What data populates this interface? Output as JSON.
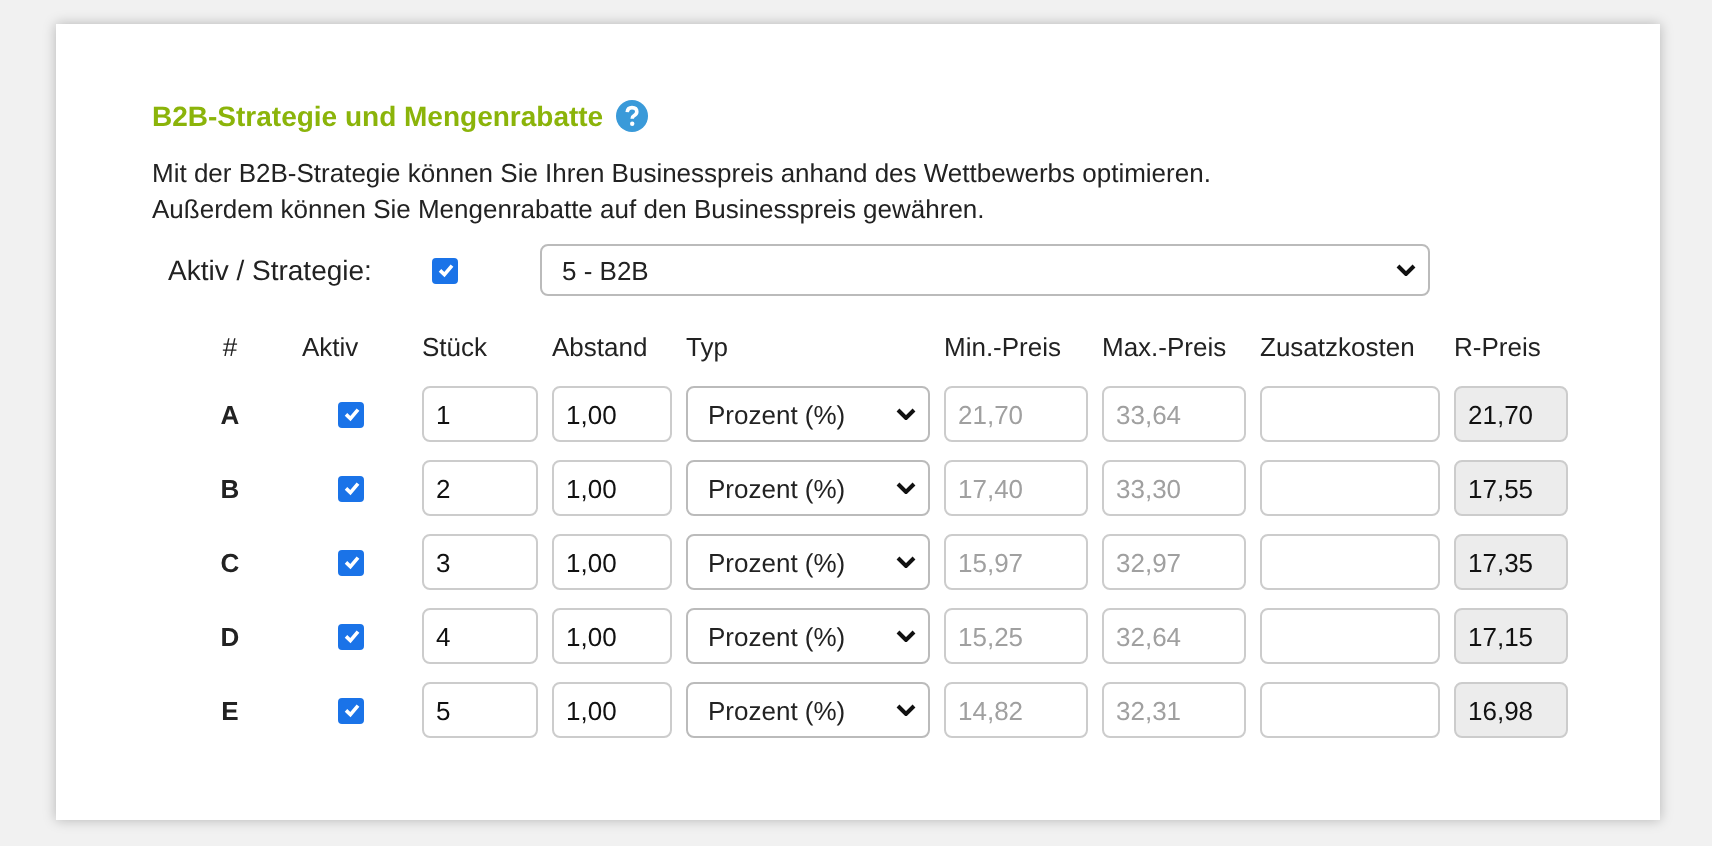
{
  "section": {
    "title": "B2B-Strategie und Mengenrabatte",
    "description": [
      "Mit der B2B-Strategie können Sie Ihren Businesspreis anhand des Wettbewerbs optimieren.",
      "Außerdem können Sie Mengenrabatte auf den Businesspreis gewähren."
    ]
  },
  "strategy": {
    "label": "Aktiv / Strategie:",
    "checked": true,
    "value": "5 - B2B"
  },
  "table": {
    "columns": [
      "#",
      "Aktiv",
      "Stück",
      "Abstand",
      "Typ",
      "Min.-Preis",
      "Max.-Preis",
      "Zusatzkosten",
      "R-Preis"
    ],
    "rows": [
      {
        "id": "A",
        "checked": true,
        "stueck": "1",
        "abstand": "1,00",
        "typ": "Prozent (%)",
        "min_placeholder": "21,70",
        "max_placeholder": "33,64",
        "r_preis": "21,70"
      },
      {
        "id": "B",
        "checked": true,
        "stueck": "2",
        "abstand": "1,00",
        "typ": "Prozent (%)",
        "min_placeholder": "17,40",
        "max_placeholder": "33,30",
        "r_preis": "17,55"
      },
      {
        "id": "C",
        "checked": true,
        "stueck": "3",
        "abstand": "1,00",
        "typ": "Prozent (%)",
        "min_placeholder": "15,97",
        "max_placeholder": "32,97",
        "r_preis": "17,35"
      },
      {
        "id": "D",
        "checked": true,
        "stueck": "4",
        "abstand": "1,00",
        "typ": "Prozent (%)",
        "min_placeholder": "15,25",
        "max_placeholder": "32,64",
        "r_preis": "17,15"
      },
      {
        "id": "E",
        "checked": true,
        "stueck": "5",
        "abstand": "1,00",
        "typ": "Prozent (%)",
        "min_placeholder": "14,82",
        "max_placeholder": "32,31",
        "r_preis": "16,98"
      }
    ]
  }
}
